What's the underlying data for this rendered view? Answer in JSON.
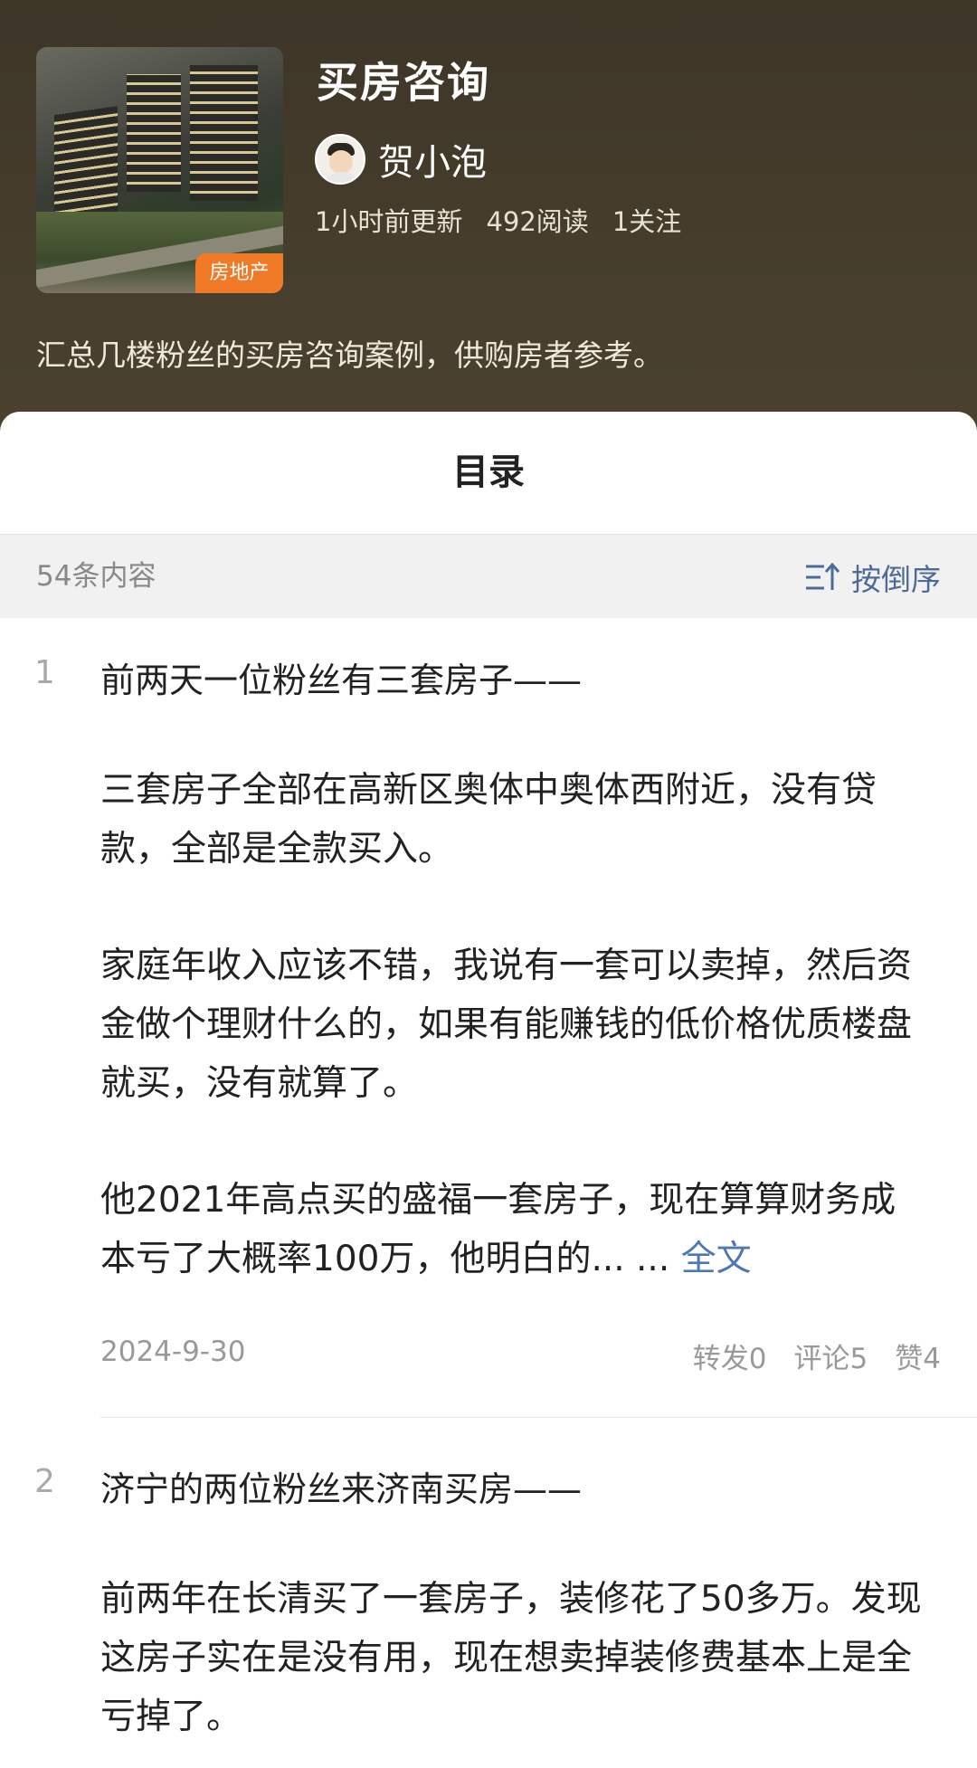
{
  "album": {
    "title": "买房咨询",
    "category_badge": "房地产",
    "author": "贺小泡",
    "stats": {
      "updated": "1小时前更新",
      "reads": "492阅读",
      "follows": "1关注"
    },
    "description": "汇总几楼粉丝的买房咨询案例，供购房者参考。"
  },
  "sheet": {
    "title": "目录",
    "count": "54条内容",
    "sort_label": "按倒序"
  },
  "items": [
    {
      "index": "1",
      "title": "前两天一位粉丝有三套房子——",
      "paragraphs": [
        "三套房子全部在高新区奥体中奥体西附近，没有贷款，全部是全款买入。",
        "家庭年收入应该不错，我说有一套可以卖掉，然后资金做个理财什么的，如果有能赚钱的低价格优质楼盘就买，没有就算了。",
        "他2021年高点买的盛福一套房子，现在算算财务成本亏了大概率100万，他明白的... ..."
      ],
      "more_link": "全文",
      "date": "2024-9-30",
      "reposts": "转发0",
      "comments": "评论5",
      "likes": "赞4"
    },
    {
      "index": "2",
      "title": "济宁的两位粉丝来济南买房——",
      "paragraphs": [
        "前两年在长清买了一套房子，装修花了50多万。发现这房子实在是没有用，现在想卖掉装修费基本上是全亏掉了。"
      ]
    }
  ]
}
